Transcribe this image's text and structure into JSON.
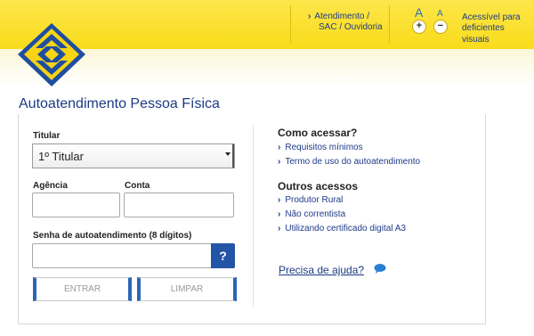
{
  "header": {
    "help_link_line1": "Atendimento /",
    "help_link_line2": "SAC / Ouvidoria",
    "font_large": "A",
    "font_small": "A",
    "font_increase": "+",
    "font_decrease": "−",
    "accessibility_line1": "Acessível para",
    "accessibility_line2": "deficientes visuais"
  },
  "page": {
    "title": "Autoatendimento Pessoa Física"
  },
  "form": {
    "titular_label": "Titular",
    "titular_selected": "1º Titular",
    "agencia_label": "Agência",
    "agencia_value": "",
    "conta_label": "Conta",
    "conta_value": "",
    "senha_label": "Senha de autoatendimento (8 dígitos)",
    "senha_value": "",
    "help_button": "?",
    "enter_button": "ENTRAR",
    "clear_button": "LIMPAR"
  },
  "sidebar": {
    "how_heading": "Como acessar?",
    "how_links": [
      "Requisitos mínimos",
      "Termo de uso do autoatendimento"
    ],
    "other_heading": "Outros acessos",
    "other_links": [
      "Produtor Rural",
      "Não correntista",
      "Utilizando certificado digital A3"
    ],
    "help_link": "Precisa de ajuda?"
  },
  "colors": {
    "brand_yellow": "#fde64a",
    "brand_blue": "#2454a6",
    "title_blue": "#1b3b83"
  },
  "icons": [
    "bb-logo",
    "chevron-right-icon",
    "question-icon",
    "chat-bubble-icon"
  ]
}
